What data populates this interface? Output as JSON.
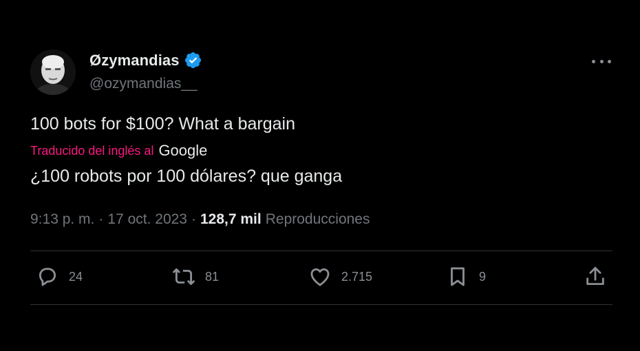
{
  "user": {
    "display_name": "Øzymandias",
    "handle": "@ozymandias__",
    "verified_icon": "verified-badge-icon",
    "verified_color": "#1d9bf0"
  },
  "tweet": {
    "text": "100 bots for $100? What a bargain",
    "translation_label": "Traducido del inglés al",
    "translation_provider": "Google",
    "translated_text": "¿100 robots por 100 dólares? que ganga",
    "time": "9:13 p. m.",
    "separator": "·",
    "date": "17 oct. 2023",
    "views_count": "128,7 mil",
    "views_label": "Reproducciones"
  },
  "actions": {
    "replies": "24",
    "reposts": "81",
    "likes": "2.715",
    "bookmarks": "9"
  },
  "colors": {
    "background": "#000000",
    "text": "#e7e9ea",
    "secondary": "#71767b",
    "translate_accent": "#f91880",
    "divider": "#2f3336"
  }
}
